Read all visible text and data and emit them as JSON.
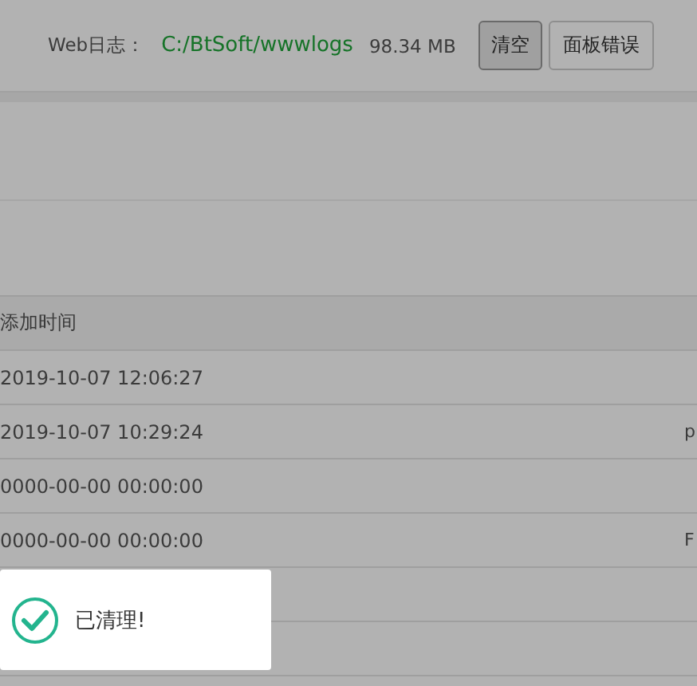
{
  "log_bar": {
    "label": "Web日志：",
    "path": "C:/BtSoft/wwwlogs",
    "size": "98.34 MB",
    "buttons": [
      "清空",
      "面板错误"
    ]
  },
  "table": {
    "columns": [
      "添加时间"
    ],
    "rows": [
      {
        "time": "2019-10-07 12:06:27"
      },
      {
        "time": "2019-10-07 10:29:24",
        "column_2": "p"
      },
      {
        "time": "0000-00-00 00:00:00"
      },
      {
        "time": "0000-00-00 00:00:00",
        "column_2": "F"
      },
      {},
      {}
    ]
  },
  "toast": {
    "kind": "success",
    "message": "已清理!"
  }
}
